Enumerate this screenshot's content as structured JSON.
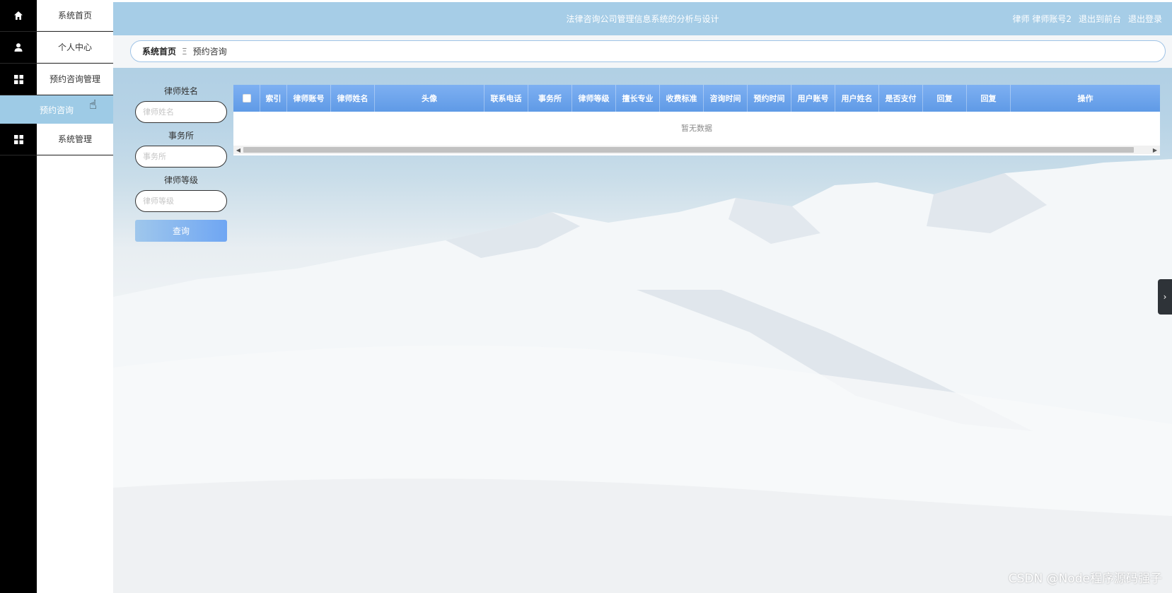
{
  "header": {
    "title": "法律咨询公司管理信息系统的分析与设计",
    "user": "律师 律师账号2",
    "exit_front": "退出到前台",
    "logout": "退出登录"
  },
  "sidebar": {
    "items": [
      {
        "label": "系统首页",
        "icon": "home-icon"
      },
      {
        "label": "个人中心",
        "icon": "user-icon"
      },
      {
        "label": "预约咨询管理",
        "icon": "grid-icon"
      },
      {
        "label": "系统管理",
        "icon": "grid-icon"
      }
    ],
    "active_sub": "预约咨询"
  },
  "breadcrumb": {
    "home": "系统首页",
    "separator": "Ξ",
    "current": "预约咨询"
  },
  "search": {
    "lawyer_name_label": "律师姓名",
    "lawyer_name_placeholder": "律师姓名",
    "firm_label": "事务所",
    "firm_placeholder": "事务所",
    "level_label": "律师等级",
    "level_placeholder": "律师等级",
    "query_button": "查询"
  },
  "table": {
    "columns": [
      "索引",
      "律师账号",
      "律师姓名",
      "头像",
      "联系电话",
      "事务所",
      "律师等级",
      "擅长专业",
      "收费标准",
      "咨询时间",
      "预约时间",
      "用户账号",
      "用户姓名",
      "是否支付",
      "回复",
      "回复",
      "操作"
    ],
    "empty_text": "暂无数据"
  },
  "side_tab": "›",
  "watermark": "CSDN @Node程序源码强子",
  "colors": {
    "topbar": "#a6cde7",
    "active_menu": "#9ecbe6",
    "table_header": "#6ea5ec",
    "query_button": "#86b5ef"
  }
}
